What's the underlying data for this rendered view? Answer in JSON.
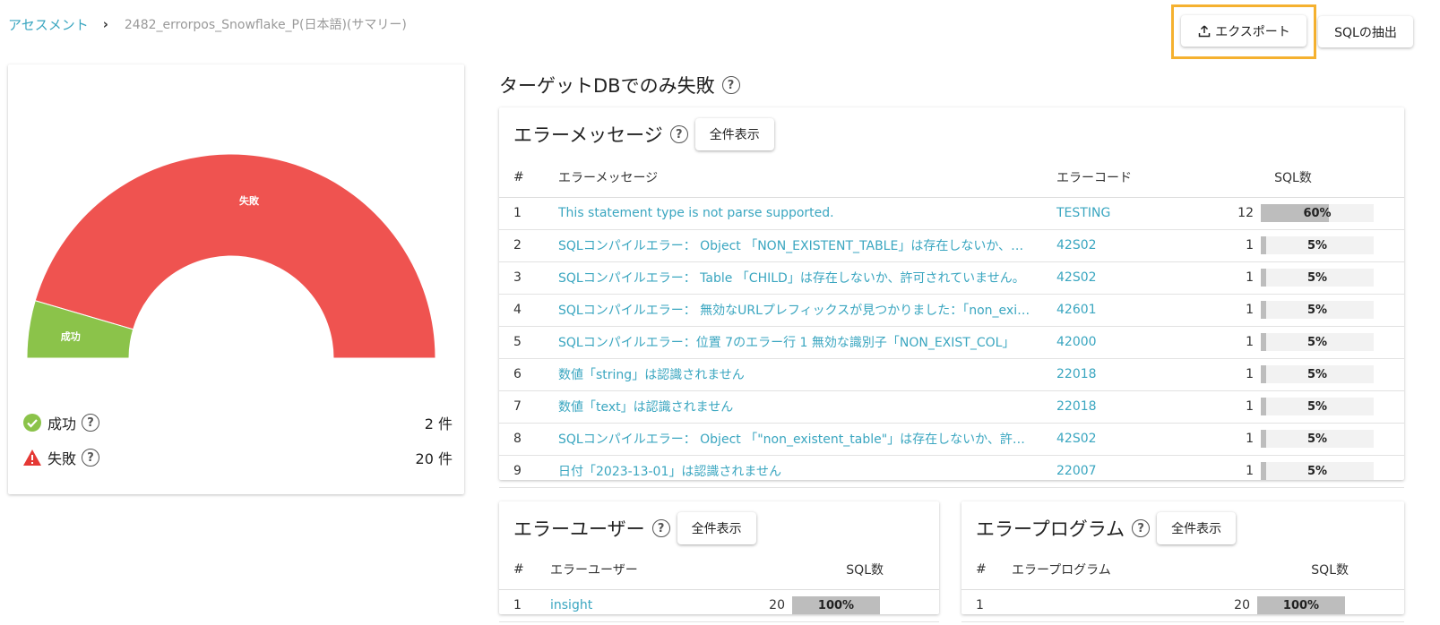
{
  "breadcrumb": {
    "root": "アセスメント",
    "current": "2482_errorpos_Snowflake_P(日本語)(サマリー)"
  },
  "toolbar": {
    "export_label": "エクスポート",
    "sql_extract_label": "SQLの抽出"
  },
  "colors": {
    "success": "#8bc34a",
    "failure": "#ef5350",
    "link": "#3aa6c0",
    "highlight": "#f5b12f"
  },
  "summary": {
    "gauge": {
      "success_label": "成功",
      "failure_label": "失敗",
      "success": 2,
      "failure": 20
    },
    "legend": [
      {
        "icon": "check-circle-icon",
        "label": "成功",
        "count": "2 件"
      },
      {
        "icon": "warning-triangle-icon",
        "label": "失敗",
        "count": "20 件"
      }
    ]
  },
  "target_section": {
    "title": "ターゲットDBでのみ失敗"
  },
  "error_messages": {
    "title": "エラーメッセージ",
    "show_all": "全件表示",
    "headers": {
      "num": "#",
      "message": "エラーメッセージ",
      "code": "エラーコード",
      "sql_count": "SQL数"
    },
    "rows": [
      {
        "num": "1",
        "message": "This statement type is not parse supported.",
        "code": "TESTING",
        "count": "12",
        "pct": "60%",
        "fraction": 0.6
      },
      {
        "num": "2",
        "message": "SQLコンパイルエラー： Object 「NON_EXISTENT_TABLE」は存在しないか、許可されていません。",
        "code": "42S02",
        "count": "1",
        "pct": "5%",
        "fraction": 0.05
      },
      {
        "num": "3",
        "message": "SQLコンパイルエラー： Table 「CHILD」は存在しないか、許可されていません。",
        "code": "42S02",
        "count": "1",
        "pct": "5%",
        "fraction": 0.05
      },
      {
        "num": "4",
        "message": "SQLコンパイルエラー： 無効なURLプレフィックスが見つかりました：「non_existent」",
        "code": "42601",
        "count": "1",
        "pct": "5%",
        "fraction": 0.05
      },
      {
        "num": "5",
        "message": "SQLコンパイルエラー：位置 7のエラー行 1 無効な識別子「NON_EXIST_COL」",
        "code": "42000",
        "count": "1",
        "pct": "5%",
        "fraction": 0.05
      },
      {
        "num": "6",
        "message": "数値「string」は認識されません",
        "code": "22018",
        "count": "1",
        "pct": "5%",
        "fraction": 0.05
      },
      {
        "num": "7",
        "message": "数値「text」は認識されません",
        "code": "22018",
        "count": "1",
        "pct": "5%",
        "fraction": 0.05
      },
      {
        "num": "8",
        "message": "SQLコンパイルエラー： Object 「\"non_existent_table\"」は存在しないか、許可されていません。",
        "code": "42S02",
        "count": "1",
        "pct": "5%",
        "fraction": 0.05
      },
      {
        "num": "9",
        "message": "日付「2023-13-01」は認識されません",
        "code": "22007",
        "count": "1",
        "pct": "5%",
        "fraction": 0.05
      }
    ]
  },
  "error_users": {
    "title": "エラーユーザー",
    "show_all": "全件表示",
    "headers": {
      "num": "#",
      "user": "エラーユーザー",
      "sql_count": "SQL数"
    },
    "rows": [
      {
        "num": "1",
        "user": "insight",
        "count": "20",
        "pct": "100%",
        "fraction": 1.0
      }
    ]
  },
  "error_programs": {
    "title": "エラープログラム",
    "show_all": "全件表示",
    "headers": {
      "num": "#",
      "program": "エラープログラム",
      "sql_count": "SQL数"
    },
    "rows": [
      {
        "num": "1",
        "program": "",
        "count": "20",
        "pct": "100%",
        "fraction": 1.0
      }
    ]
  }
}
